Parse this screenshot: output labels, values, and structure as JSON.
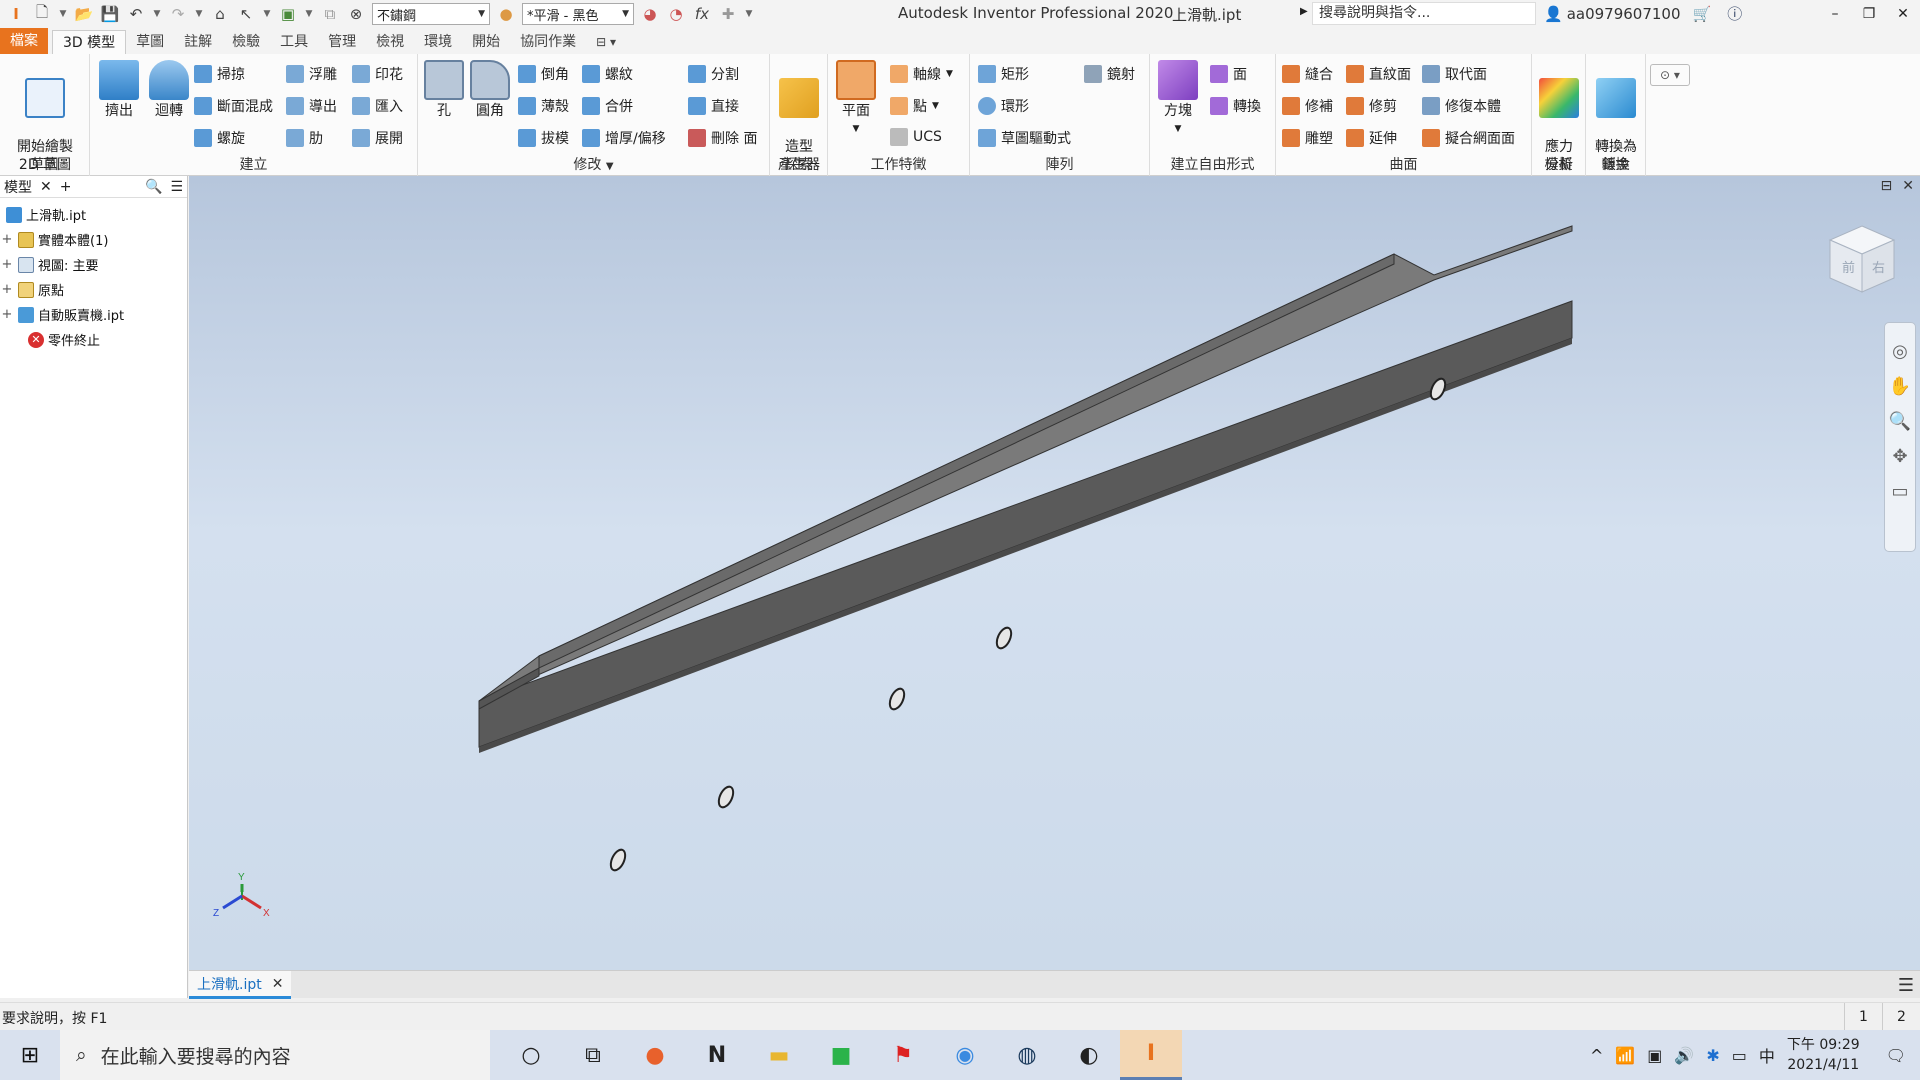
{
  "titlebar": {
    "material": "不鏽鋼",
    "appearance": "*平滑 - 黑色",
    "app_title": "Autodesk Inventor Professional 2020",
    "file_title": "上滑軌.ipt",
    "search_placeholder": "搜尋說明與指令...",
    "user": "aa0979607100"
  },
  "tabs": [
    "檔案",
    "3D 模型",
    "草圖",
    "註解",
    "檢驗",
    "工具",
    "管理",
    "檢視",
    "環境",
    "開始",
    "協同作業"
  ],
  "ribbon": {
    "sketch": {
      "title": "草圖",
      "start_sketch": "開始繪製\n2D 草圖"
    },
    "create": {
      "title": "建立",
      "extrude": "擠出",
      "revolve": "迴轉",
      "sweep": "掃掠",
      "loft": "斷面混成",
      "coil": "螺旋",
      "emboss": "浮雕",
      "derive": "導出",
      "rib": "肋",
      "decal": "印花",
      "import": "匯入",
      "unfold": "展開"
    },
    "modify": {
      "title": "修改",
      "hole": "孔",
      "fillet": "圓角",
      "chamfer": "倒角",
      "shell": "薄殼",
      "draft": "拔模",
      "thread": "螺紋",
      "combine": "合併",
      "thicken": "增厚/偏移",
      "split": "分割",
      "direct": "直接",
      "delete_face": "刪除 面"
    },
    "explore": {
      "title": "探索",
      "shape_generator": "造型\n產生器"
    },
    "work": {
      "title": "工作特徵",
      "plane": "平面",
      "axis": "軸線",
      "point": "點",
      "ucs": "UCS"
    },
    "pattern": {
      "title": "陣列",
      "rect": "矩形",
      "circ": "環形",
      "sketch_driven": "草圖驅動式",
      "mirror": "鏡射"
    },
    "freeform": {
      "title": "建立自由形式",
      "box": "方塊",
      "face": "面",
      "convert": "轉換"
    },
    "surface": {
      "title": "曲面",
      "stitch": "縫合",
      "patch": "修補",
      "sculpt": "雕塑",
      "ruled": "直紋面",
      "trim": "修剪",
      "extend": "延伸",
      "replace": "取代面",
      "repair": "修復本體",
      "fit_mesh": "擬合網面面"
    },
    "simulation": {
      "title": "模擬",
      "stress": "應力\n分析"
    },
    "convert": {
      "title": "轉換",
      "sheet_metal": "轉換為\n鈑金"
    }
  },
  "browser": {
    "tab_label": "模型",
    "items": [
      {
        "label": "上滑軌.ipt"
      },
      {
        "label": "實體本體(1)"
      },
      {
        "label": "視圖: 主要"
      },
      {
        "label": "原點"
      },
      {
        "label": "自動販賣機.ipt"
      },
      {
        "label": "零件終止"
      }
    ]
  },
  "viewcube": {
    "front": "前",
    "right": "右"
  },
  "doctab": {
    "label": "上滑軌.ipt"
  },
  "status": {
    "text": "要求說明，按 F1",
    "num1": "1",
    "num2": "2"
  },
  "taskbar": {
    "search_placeholder": "在此輸入要搜尋的內容",
    "time": "下午 09:29",
    "date": "2021/4/11",
    "ime": "中"
  },
  "colors": {
    "accent": "#e8731e",
    "part": "#6a6a6a"
  }
}
